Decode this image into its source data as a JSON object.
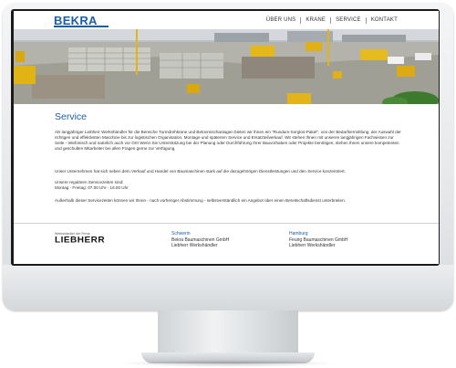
{
  "brand": {
    "logo": "BEKRA"
  },
  "nav": {
    "items": [
      "ÜBER UNS",
      "KRANE",
      "SERVICE",
      "KONTAKT"
    ]
  },
  "page": {
    "title": "Service",
    "p1": "Als langjähriger Liebherr Werkshändler für die Bereiche Turmdrehkrane und Betonmischanlagen bieten wir Ihnen ein \"Rundum-Sorglos-Paket\", von der Bedarfsermittlung, der Auswahl der richtigen und effektivsten Maschine bis zur logistischen Organisation, Montage und späterem Service und Ersatzteilverkauf. Wir stehen Ihnen mit unseren langjährigen Fachwissen zur Seite - telefonisch und natürlich auch vor Ort! Wenn Sie Unterstützung bei der Planung oder Durchführung Ihrer Bauvorhaben oder Projekte benötigen, stehen Ihnen unsere kompetenten und geschulten Mitarbeiter bei allen Fragen gerne zur Verfügung.",
    "p2": "Unser Unternehmen hat sich neben dem Verkauf und Handel von Baumaschinen stark auf die dazugehörigen Dienstleistungen und den Service konzentriert.",
    "p3_label": "Unsere regulären Servicezeiten sind:",
    "p3_hours": "Montag - Freitag: 07.00 Uhr - 16.00 Uhr",
    "p4": "Außerhalb dieser Servicezeiten können wir Ihnen - nach vorheriger Abstimmung - selbstverständlich ein Angebot über einen Bereitschaftsdienst unterbreiten."
  },
  "footer": {
    "partner_label": "Werkshändler der Firma",
    "partner_brand": "LIEBHERR",
    "locations": [
      {
        "city": "Schwerin",
        "company": "Bekra Baumaschinen GmbH",
        "role": "Liebherr Werkshändler"
      },
      {
        "city": "Hamburg",
        "company": "Feurig Baumaschinen GmbH",
        "role": "Liebherr Werkshändler"
      }
    ]
  }
}
